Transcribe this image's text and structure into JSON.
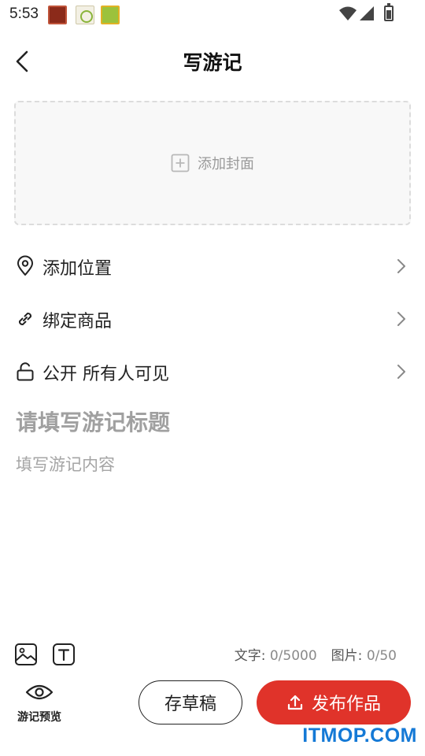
{
  "status_bar": {
    "time": "5:53",
    "notification_icons": [
      "app-notification-icon",
      "app-notification-icon",
      "app-notification-icon"
    ],
    "system_icons": [
      "wifi-icon",
      "cellular-signal-icon",
      "battery-charging-icon"
    ]
  },
  "header": {
    "title": "写游记",
    "back_icon": "chevron-left-icon"
  },
  "cover": {
    "label": "添加封面",
    "icon": "plus-square-icon"
  },
  "options": [
    {
      "label": "添加位置",
      "icon": "location-pin-icon"
    },
    {
      "label": "绑定商品",
      "icon": "link-icon"
    },
    {
      "label": "公开 所有人可见",
      "icon": "unlock-icon"
    }
  ],
  "editor": {
    "title_placeholder": "请填写游记标题",
    "title_value": "",
    "content_placeholder": "填写游记内容",
    "content_value": ""
  },
  "toolbar": {
    "text_count_label": "文字:",
    "text_count_value": "0/5000",
    "image_count_label": "图片:",
    "image_count_value": "0/50"
  },
  "bottom_bar": {
    "preview_label": "游记预览",
    "draft_label": "存草稿",
    "publish_label": "发布作品"
  },
  "colors": {
    "accent": "#e0332a",
    "watermark": "#1479d6"
  },
  "watermark": "ITMOP.COM"
}
